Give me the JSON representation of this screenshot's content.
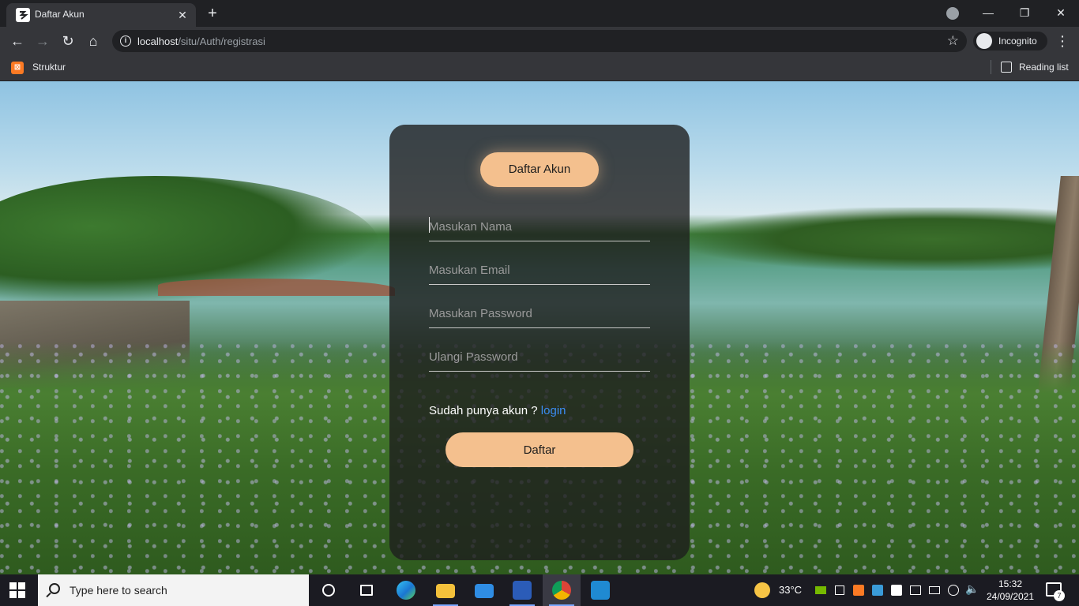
{
  "browser": {
    "tab_title": "Daftar Akun",
    "new_tab_symbol": "+",
    "url_host": "localhost",
    "url_path": "/situ/Auth/registrasi",
    "incognito_label": "Incognito",
    "bookmark_label": "Struktur",
    "reading_list_label": "Reading list"
  },
  "form": {
    "title": "Daftar Akun",
    "fields": [
      {
        "placeholder": "Masukan Nama",
        "value": ""
      },
      {
        "placeholder": "Masukan Email",
        "value": ""
      },
      {
        "placeholder": "Masukan Password",
        "value": ""
      },
      {
        "placeholder": "Ulangi Password",
        "value": ""
      }
    ],
    "have_account_text": "Sudah punya akun ? ",
    "login_link": "login",
    "submit_label": "Daftar"
  },
  "taskbar": {
    "search_placeholder": "Type here to search",
    "temperature": "33°C",
    "time": "15:32",
    "date": "24/09/2021",
    "notification_count": "7",
    "apps": [
      "cortana-icon",
      "task-view-icon",
      "edge-icon",
      "file-explorer-icon",
      "mail-icon",
      "word-icon",
      "chrome-icon",
      "vscode-icon"
    ]
  },
  "colors": {
    "accent_peach": "#f4c08e",
    "link_blue": "#3b8cf2",
    "chrome_dark": "#202124",
    "chrome_toolbar": "#35363a",
    "taskbar": "#1b1b22"
  }
}
